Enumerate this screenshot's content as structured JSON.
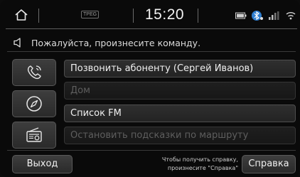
{
  "status_bar": {
    "home_icon": "home-icon",
    "tpeg_label": "TPEG",
    "time": "15:20",
    "icons": [
      "battery-icon",
      "bluetooth-icon",
      "signal-icon",
      "wifi-icon"
    ]
  },
  "prompt": {
    "icon": "speaker-icon",
    "text": "Пожалуйста, произнесите команду."
  },
  "side_buttons": [
    {
      "icon": "phone-icon"
    },
    {
      "icon": "navigation-compass-icon"
    },
    {
      "icon": "radio-icon"
    }
  ],
  "commands": [
    {
      "label": "Позвонить абоненту (Сергей Иванов)",
      "enabled": true
    },
    {
      "label": "Дом",
      "enabled": false
    },
    {
      "label": "Список FM",
      "enabled": true
    },
    {
      "label": "Остановить подсказки по маршруту",
      "enabled": false
    }
  ],
  "bottom": {
    "exit_label": "Выход",
    "hint_line1": "Чтобы получить справку,",
    "hint_line2": "произнесите \"Справка\"",
    "help_label": "Справка"
  }
}
